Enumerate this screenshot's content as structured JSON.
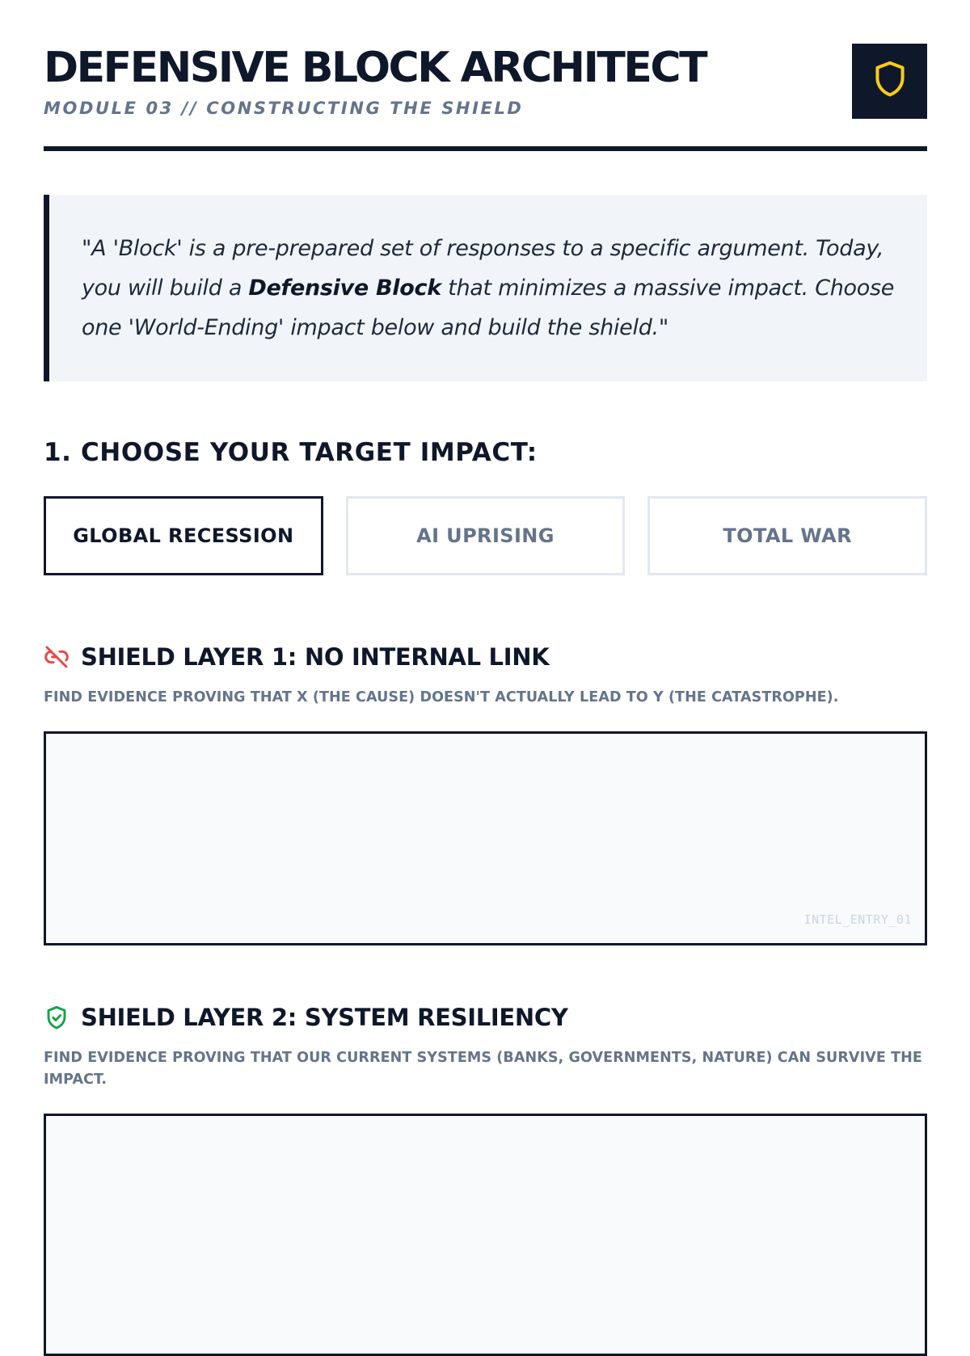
{
  "header": {
    "title": "DEFENSIVE BLOCK ARCHITECT",
    "subtitle": "MODULE 03 // CONSTRUCTING THE SHIELD",
    "badge_icon": "shield-icon",
    "badge_icon_color": "#facc15"
  },
  "intro": {
    "text_before": "\"A 'Block' is a pre-prepared set of responses to a specific argument. Today, you will build a ",
    "emphasis": "Defensive Block",
    "text_after": " that minimizes a massive impact. Choose one 'World-Ending' impact below and build the shield.\""
  },
  "target": {
    "heading": "1. CHOOSE YOUR TARGET IMPACT:",
    "options": [
      {
        "label": "GLOBAL RECESSION",
        "selected": true
      },
      {
        "label": "AI UPRISING",
        "selected": false
      },
      {
        "label": "TOTAL WAR",
        "selected": false
      }
    ]
  },
  "layers": [
    {
      "icon": "broken-link-icon",
      "icon_color": "#ef4444",
      "title": "SHIELD LAYER 1: NO INTERNAL LINK",
      "description": "FIND EVIDENCE PROVING THAT X (THE CAUSE) DOESN'T ACTUALLY LEAD TO Y (THE CATASTROPHE).",
      "entry_value": "",
      "entry_tag": "INTEL_ENTRY_01"
    },
    {
      "icon": "shield-check-icon",
      "icon_color": "#16a34a",
      "title": "SHIELD LAYER 2: SYSTEM RESILIENCY",
      "description": "FIND EVIDENCE PROVING THAT OUR CURRENT SYSTEMS (BANKS, GOVERNMENTS, NATURE) CAN SURVIVE THE IMPACT.",
      "entry_value": ""
    }
  ],
  "colors": {
    "ink": "#0f172a",
    "muted": "#64748b",
    "panel": "#f1f5f9",
    "accent_yellow": "#facc15"
  }
}
